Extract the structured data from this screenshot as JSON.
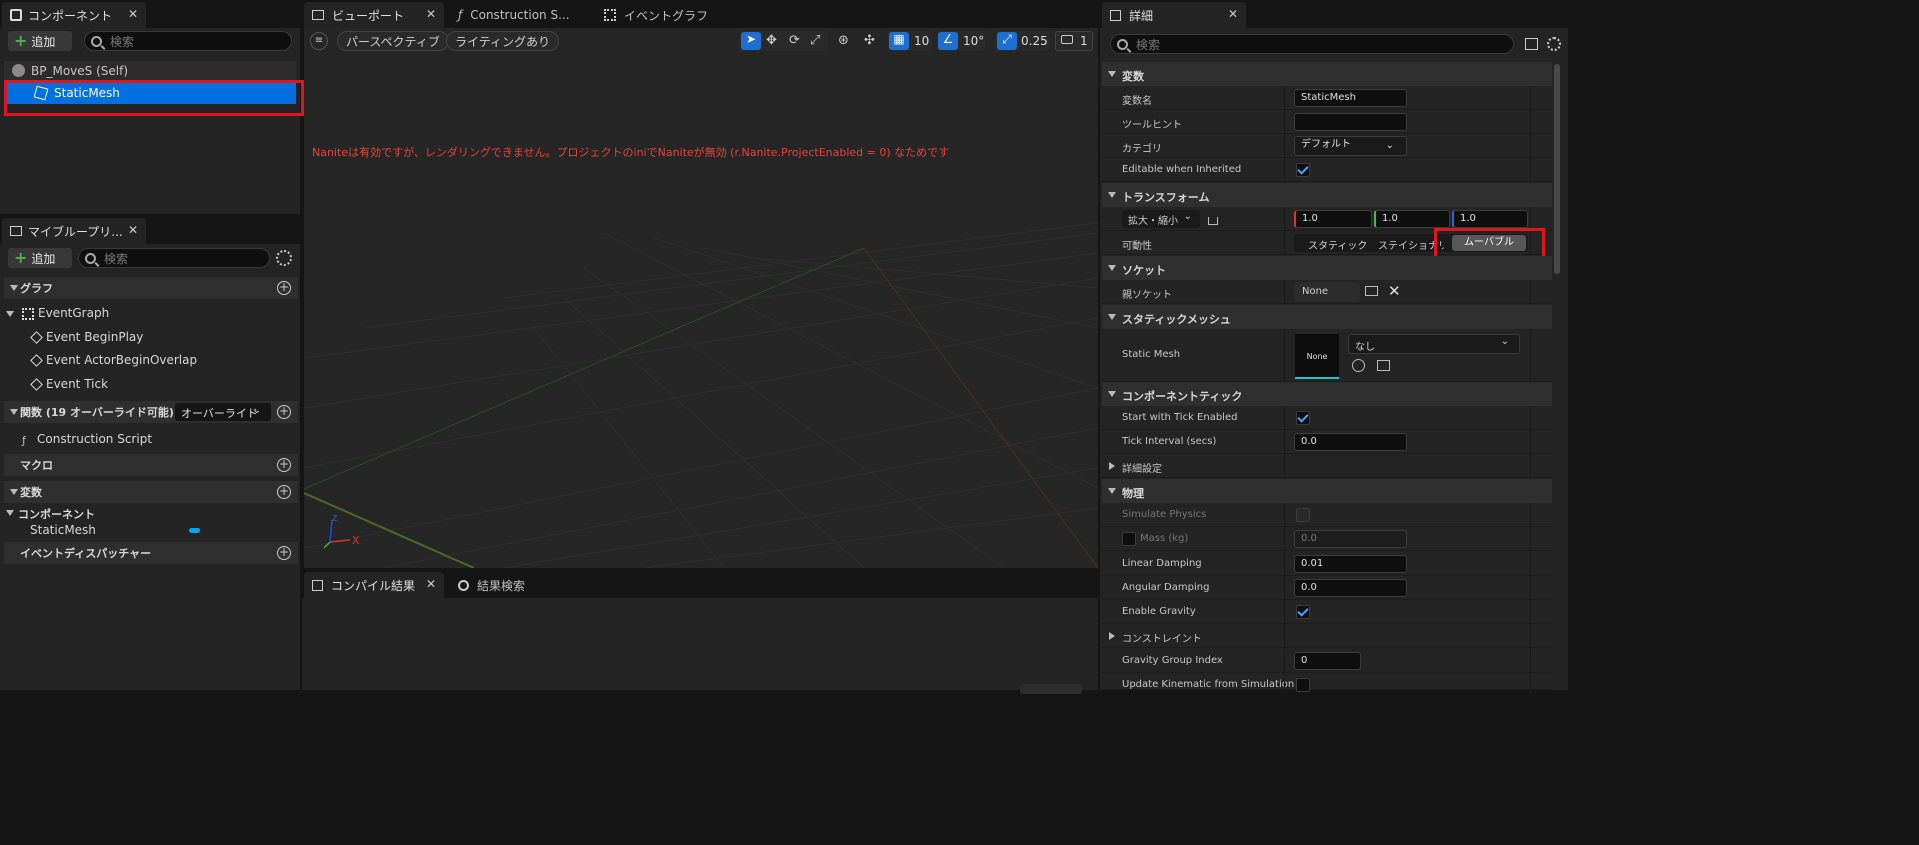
{
  "components_panel": {
    "tab_title": "コンポーネント",
    "add_label": "追加",
    "search_placeholder": "検索",
    "self_item": "BP_MoveS (Self)",
    "selected_item": "StaticMesh"
  },
  "mybp_panel": {
    "tab_title": "マイブループリ...",
    "add_label": "追加",
    "search_placeholder": "検索",
    "graph_header": "グラフ",
    "event_graph": "EventGraph",
    "events": [
      "Event BeginPlay",
      "Event ActorBeginOverlap",
      "Event Tick"
    ],
    "functions_header": "関数 (19 オーバーライド可能)",
    "override_label": "オーバーライド",
    "construction_script": "Construction Script",
    "macro_header": "マクロ",
    "variables_header": "変数",
    "components_category": "コンポーネント",
    "static_mesh_var": "StaticMesh",
    "dispatchers_header": "イベントディスパッチャー"
  },
  "viewport": {
    "tabs": [
      "ビューポート",
      "Construction S...",
      "イベントグラフ"
    ],
    "perspective_label": "パースペクティブ",
    "lighting_label": "ライティングあり",
    "grid_snap": "10",
    "rot_snap": "10°",
    "scale_snap": "0.25",
    "camera_speed": "1",
    "warning": "Naniteは有効ですが、レンダリングできません。プロジェクトのiniでNaniteが無効 (r.Nanite.ProjectEnabled = 0) なためです",
    "axis_x": "X",
    "axis_z": "Z"
  },
  "bottom_panel": {
    "compile_tab": "コンパイル結果",
    "search_tab": "結果検索"
  },
  "details": {
    "tab_title": "詳細",
    "search_placeholder": "検索",
    "sec_variable": "変数",
    "var_name_label": "変数名",
    "var_name_value": "StaticMesh",
    "tooltip_label": "ツールヒント",
    "category_label": "カテゴリ",
    "category_value": "デフォルト",
    "editable_label": "Editable when Inherited",
    "sec_transform": "トランスフォーム",
    "scale_mode": "拡大・縮小",
    "scale_x": "1.0",
    "scale_y": "1.0",
    "scale_z": "1.0",
    "mobility_label": "可動性",
    "mobility_static": "スタティック",
    "mobility_stationary": "ステイショナリ",
    "mobility_movable": "ムーバブル",
    "sec_socket": "ソケット",
    "parent_socket_label": "親ソケット",
    "parent_socket_value": "None",
    "sec_static_mesh": "スタティックメッシュ",
    "static_mesh_label": "Static Mesh",
    "static_mesh_thumb": "None",
    "static_mesh_value": "なし",
    "sec_component_tick": "コンポーネントティック",
    "start_tick_label": "Start with Tick Enabled",
    "tick_interval_label": "Tick Interval (secs)",
    "tick_interval_value": "0.0",
    "advanced_label": "詳細設定",
    "sec_physics": "物理",
    "simulate_label": "Simulate Physics",
    "mass_label": "Mass (kg)",
    "mass_value": "0.0",
    "linear_damping_label": "Linear Damping",
    "linear_damping_value": "0.01",
    "angular_damping_label": "Angular Damping",
    "angular_damping_value": "0.0",
    "gravity_label": "Enable Gravity",
    "constraints_label": "コンストレイント",
    "gravity_group_label": "Gravity Group Index",
    "gravity_group_value": "0",
    "update_kinematic_label": "Update Kinematic from Simulation"
  },
  "colors": {
    "selection": "#0070e0",
    "highlight_box": "#e0161f",
    "warning_text": "#e8433a",
    "accent_blue": "#1e6fd0"
  }
}
